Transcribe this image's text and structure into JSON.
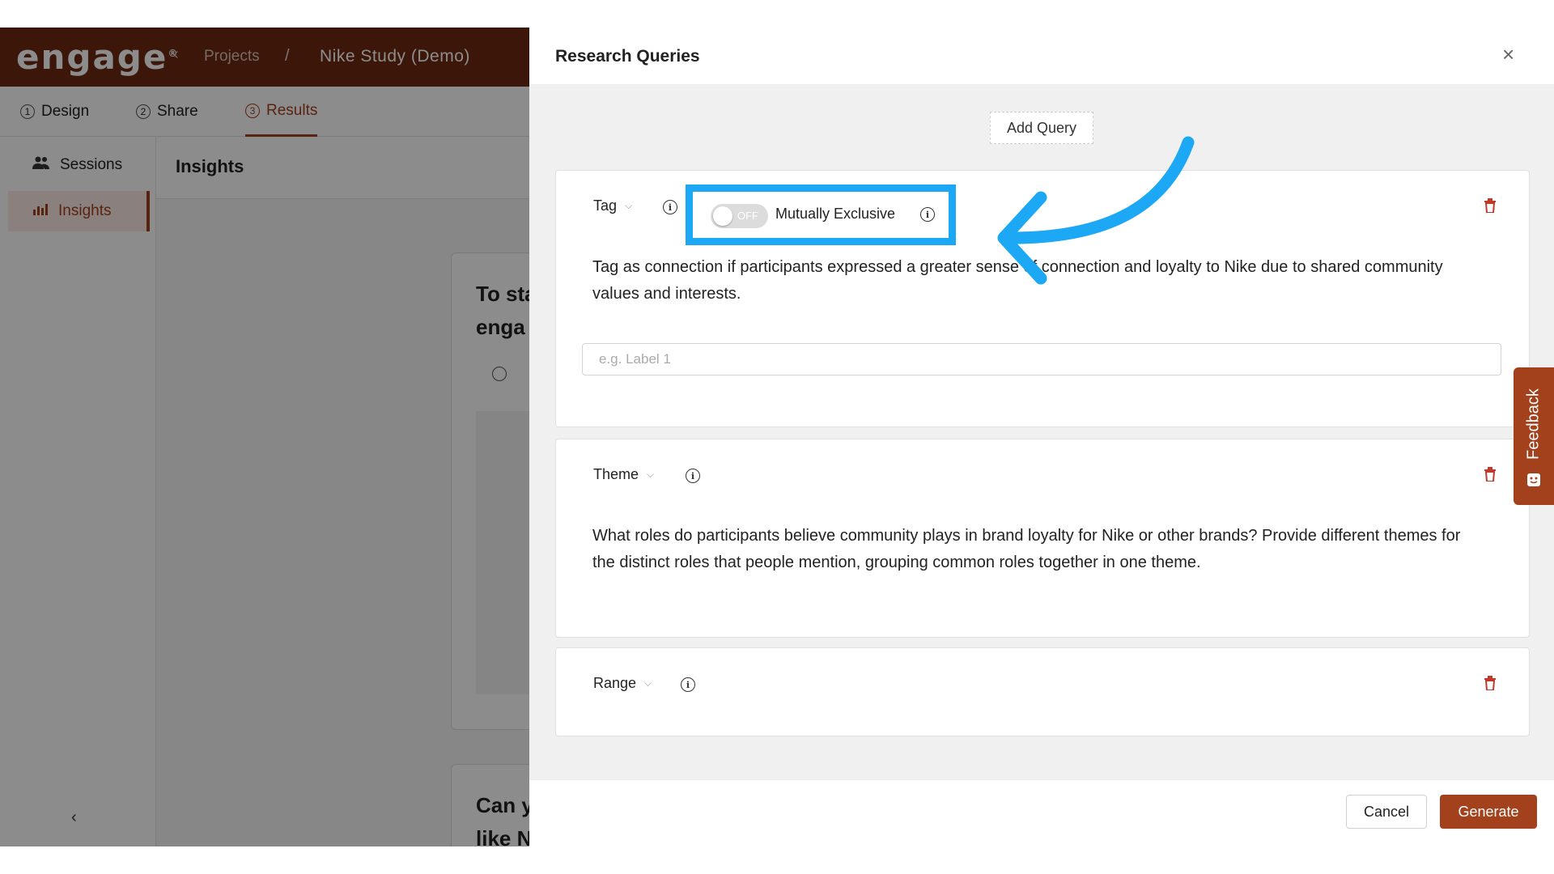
{
  "app": {
    "logo": "engage",
    "breadcrumb": {
      "projects": "Projects",
      "separator": "/",
      "study": "Nike Study (Demo)"
    },
    "steps": [
      {
        "num": "1",
        "label": "Design"
      },
      {
        "num": "2",
        "label": "Share"
      },
      {
        "num": "3",
        "label": "Results"
      }
    ],
    "sidebar": {
      "items": [
        {
          "label": "Sessions"
        },
        {
          "label": "Insights"
        }
      ],
      "collapse": "‹"
    },
    "insights_title": "Insights",
    "background_cards": [
      {
        "question": "To sta\nenga"
      },
      {
        "question": "Can y\nlike N"
      }
    ]
  },
  "drawer": {
    "title": "Research Queries",
    "close": "×",
    "add_query": "Add Query",
    "queries": [
      {
        "type": "Tag",
        "toggle_state": "OFF",
        "toggle_label": "Mutually Exclusive",
        "text": "Tag as connection if participants expressed a greater sense of connection and loyalty to Nike due to shared community values and interests.",
        "label_placeholder": "e.g. Label 1"
      },
      {
        "type": "Theme",
        "text": "What roles do participants believe community plays in brand loyalty for Nike or other brands? Provide different themes for the distinct roles that people mention, grouping common roles together in one theme."
      },
      {
        "type": "Range"
      }
    ],
    "cancel": "Cancel",
    "generate": "Generate"
  },
  "feedback": "Feedback",
  "colors": {
    "brand": "#a3411d",
    "topbar": "#6e2a12",
    "highlight": "#1da8f5",
    "trash": "#c0392b"
  },
  "icons": [
    "back-chevron-icon",
    "users-icon",
    "chart-icon",
    "info-icon",
    "chevron-down-icon",
    "trash-icon",
    "close-icon",
    "feedback-icon",
    "arrow-annotation"
  ]
}
